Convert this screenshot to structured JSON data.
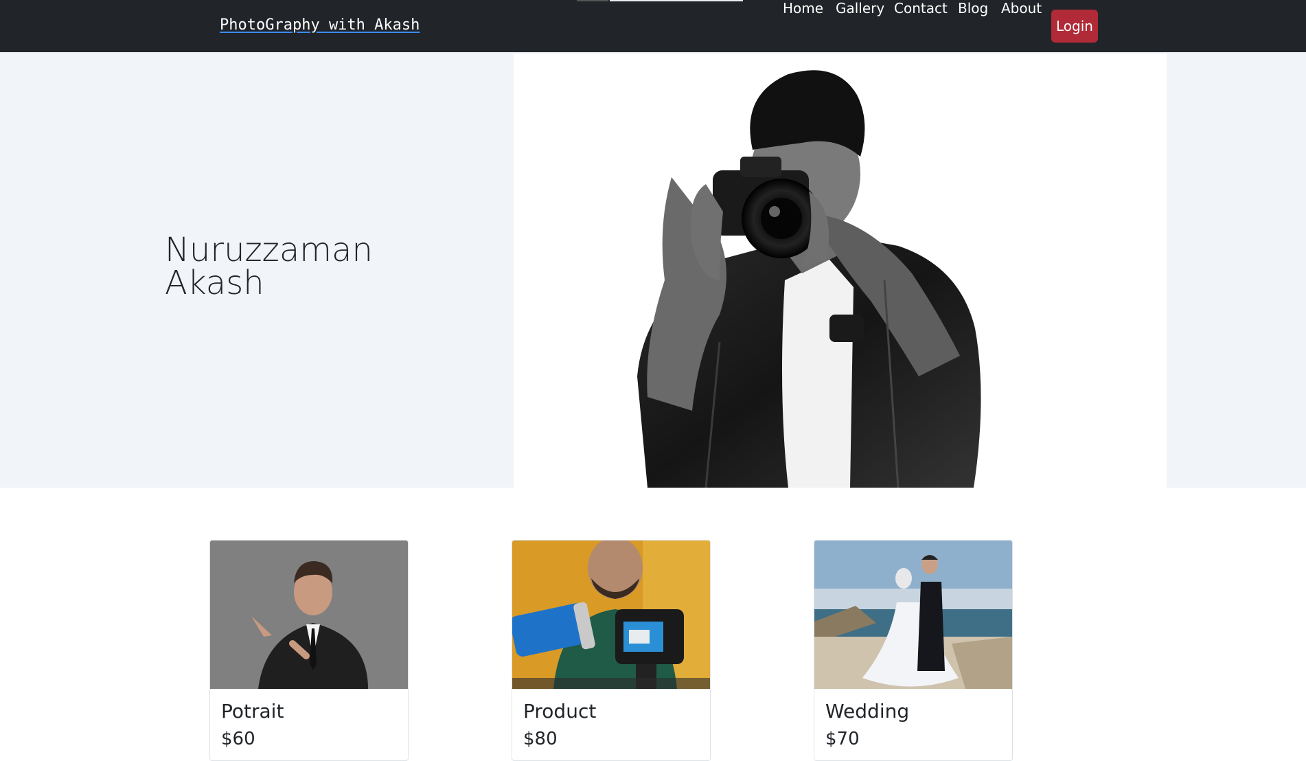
{
  "navbar": {
    "brand": "PhotoGraphy with Akash",
    "links": [
      {
        "label": "Home"
      },
      {
        "label": "Gallery"
      },
      {
        "label": "Contact"
      },
      {
        "label": "Blog"
      },
      {
        "label": "About"
      }
    ],
    "login_label": "Login"
  },
  "hero": {
    "name_line1": "Nuruzzaman",
    "name_line2": "Akash"
  },
  "cards": [
    {
      "title": "Potrait",
      "price": "$60"
    },
    {
      "title": "Product",
      "price": "$80"
    },
    {
      "title": "Wedding",
      "price": "$70"
    }
  ],
  "colors": {
    "navbar": "#212529",
    "login_button": "#b02a37",
    "hero_background": "#f1f4f8"
  }
}
